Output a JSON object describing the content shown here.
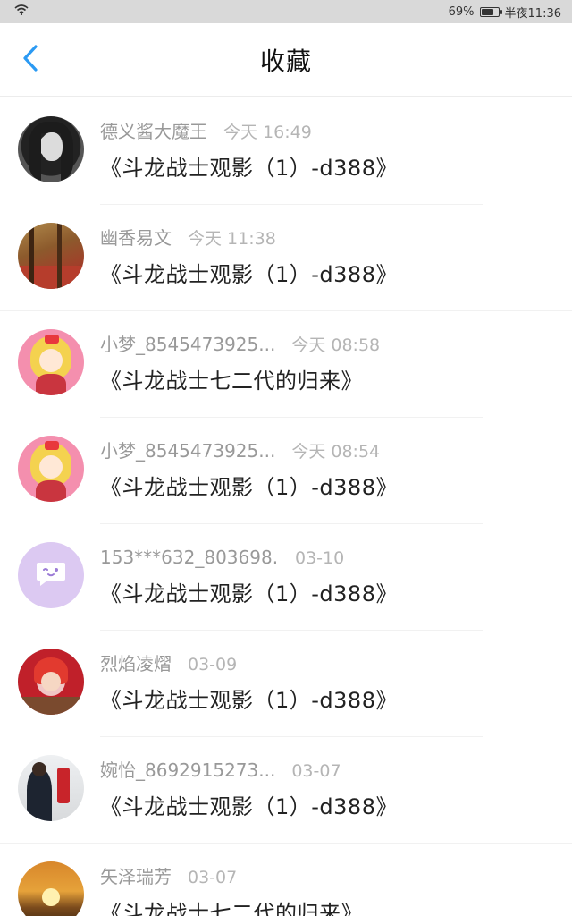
{
  "status_bar": {
    "battery": "69%",
    "battery_level": 0.69,
    "time": "半夜11:36"
  },
  "header": {
    "title": "收藏"
  },
  "items": [
    {
      "name": "德义酱大魔王",
      "time": "今天 16:49",
      "content": "《斗龙战士观影（1）-d388》"
    },
    {
      "name": "幽香易文",
      "time": "今天 11:38",
      "content": "《斗龙战士观影（1）-d388》"
    },
    {
      "name": "小梦_8545473925...",
      "time": "今天 08:58",
      "content": "《斗龙战士七二代的归来》"
    },
    {
      "name": "小梦_8545473925...",
      "time": "今天 08:54",
      "content": "《斗龙战士观影（1）-d388》"
    },
    {
      "name": "153***632_803698..",
      "time": "03-10",
      "content": "《斗龙战士观影（1）-d388》"
    },
    {
      "name": "烈焰凌熠",
      "time": "03-09",
      "content": "《斗龙战士观影（1）-d388》"
    },
    {
      "name": "婉怡_8692915273...",
      "time": "03-07",
      "content": "《斗龙战士观影（1）-d388》"
    },
    {
      "name": "矢泽瑞芳",
      "time": "03-07",
      "content": "《斗龙战士七二代的归来》"
    }
  ],
  "colors": {
    "accent": "#2b9af3",
    "status_bar_bg": "#d9d9d9"
  }
}
